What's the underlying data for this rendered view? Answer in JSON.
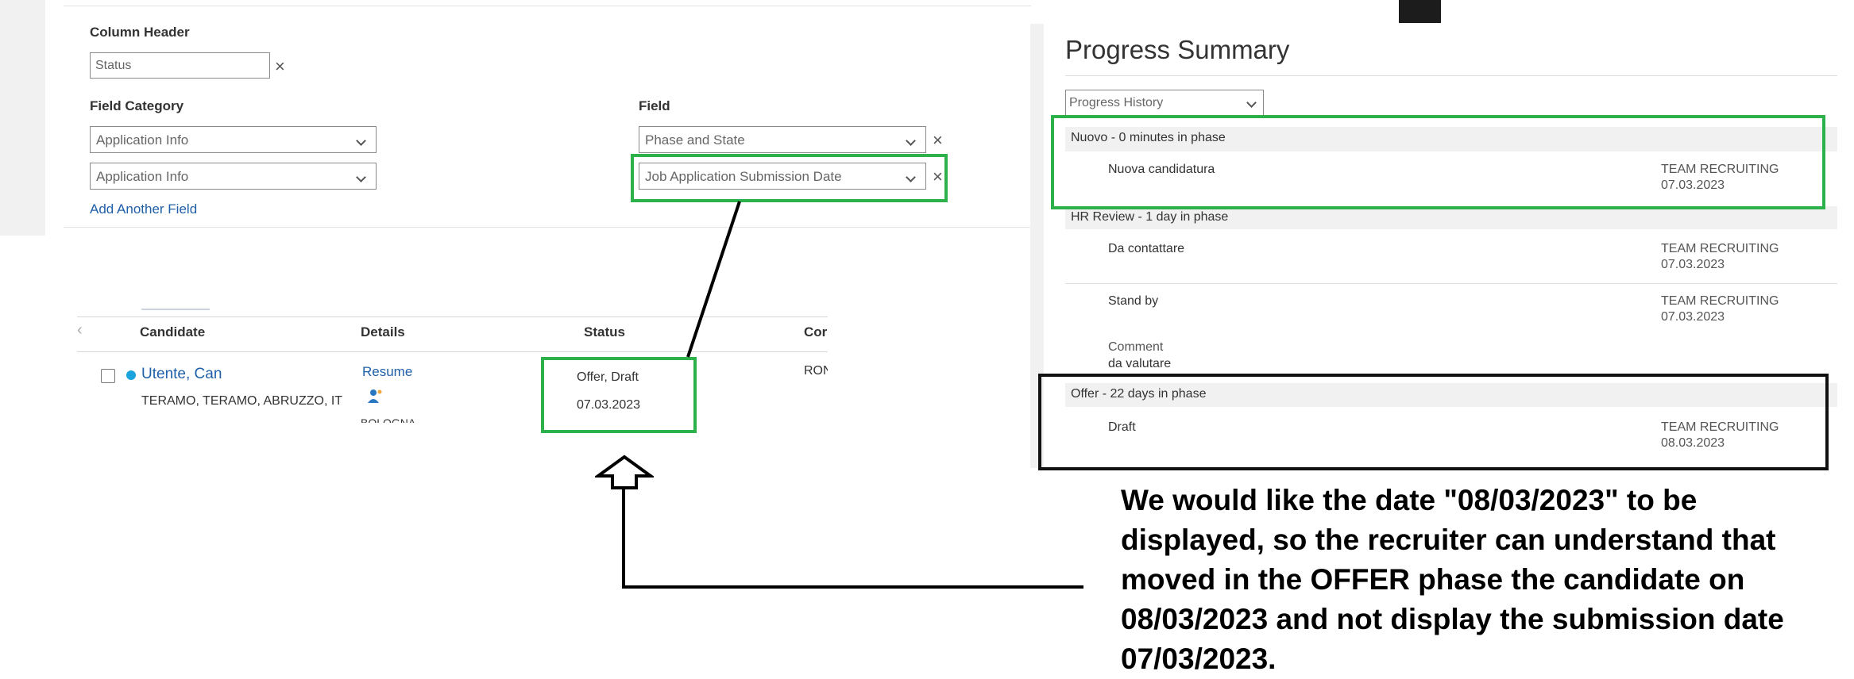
{
  "config": {
    "column_header_label": "Column Header",
    "column_header_value": "Status",
    "field_category_label": "Field Category",
    "field_label": "Field",
    "category_1": "Application Info",
    "category_2": "Application Info",
    "field_1": "Phase and State",
    "field_2": "Job Application Submission Date",
    "add_field": "Add Another Field",
    "remove": "×"
  },
  "table": {
    "headers": [
      "Candidate",
      "Details",
      "Status",
      "Cor"
    ],
    "prev": "‹",
    "row": {
      "name": "Utente, Can",
      "location": "TERAMO, TERAMO, ABRUZZO, IT",
      "details_link": "Resume",
      "details_extra": "BOLOGNA",
      "status_line1": "Offer, Draft",
      "status_line2": "07.03.2023",
      "col4": "RON"
    }
  },
  "progress": {
    "title": "Progress Summary",
    "history_select": "Progress History",
    "phases": [
      {
        "name": "Nuovo - 0 minutes in phase",
        "steps": [
          {
            "label": "Nuova candidatura",
            "who": "TEAM RECRUITING",
            "date": "07.03.2023"
          }
        ]
      },
      {
        "name": "HR Review - 1 day in phase",
        "steps": [
          {
            "label": "Da contattare",
            "who": "TEAM RECRUITING",
            "date": "07.03.2023"
          },
          {
            "label": "Stand by",
            "who": "TEAM RECRUITING",
            "date": "07.03.2023",
            "comment_label": "Comment",
            "comment": "da valutare"
          }
        ]
      },
      {
        "name": "Offer - 22 days in phase",
        "steps": [
          {
            "label": "Draft",
            "who": "TEAM RECRUITING",
            "date": "08.03.2023"
          }
        ]
      }
    ]
  },
  "annotation": {
    "lines": [
      "We would like the date \"08/03/2023\" to be",
      "displayed, so the recruiter can understand that",
      "moved in the OFFER phase the candidate on",
      "08/03/2023 and not display the submission date",
      "07/03/2023."
    ]
  },
  "colors": {
    "highlight_green": "#2db14a",
    "highlight_black": "#111111",
    "link_blue": "#1f5fa8",
    "dot_blue": "#1aa3dd"
  },
  "icons": [
    "close-icon",
    "chevron-down-icon",
    "chevron-left-icon",
    "person-icon",
    "up-arrow-icon"
  ]
}
